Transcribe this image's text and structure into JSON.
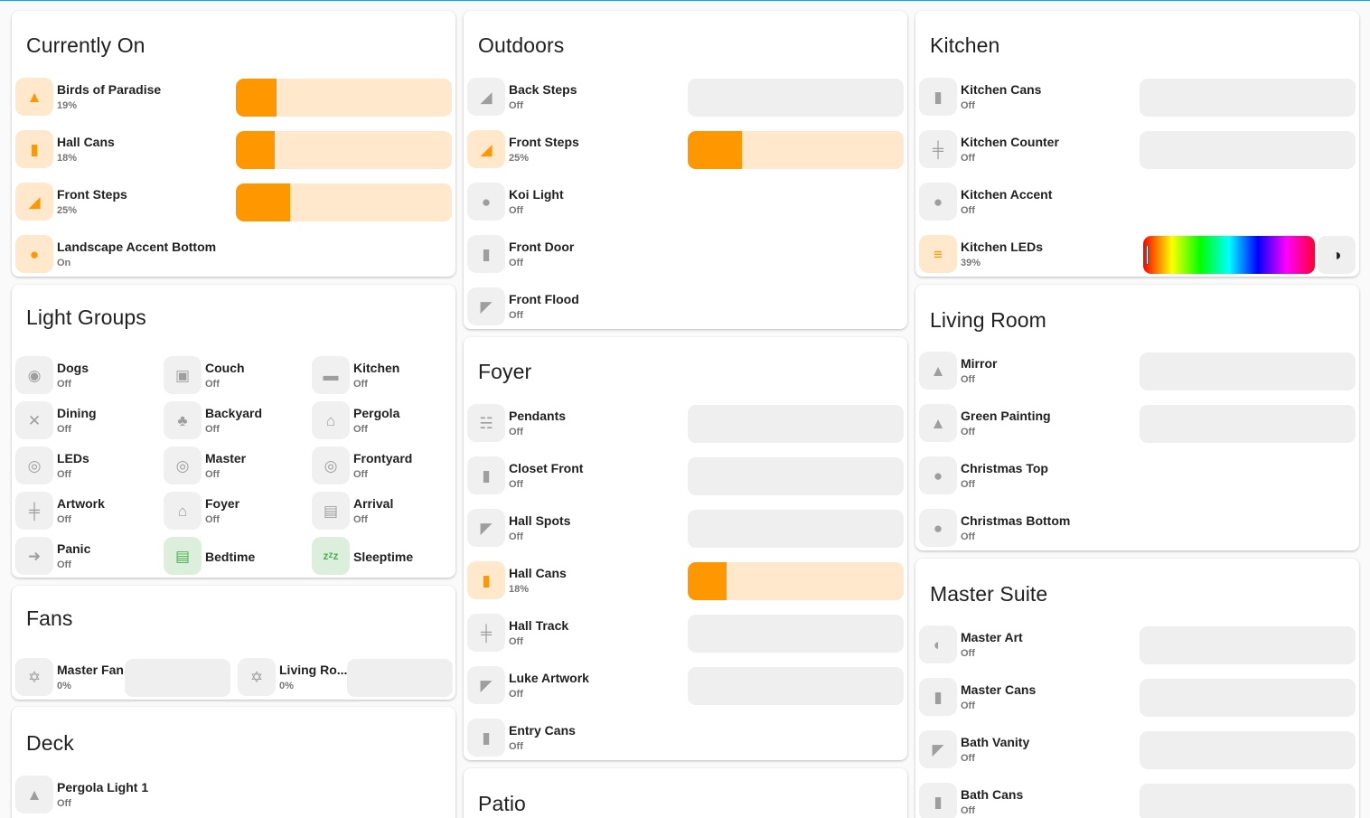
{
  "colors": {
    "accent": "#03a9f4",
    "on_orange": "#ff9800",
    "on_bg": "#ffe8cc",
    "off_bg": "#efefef",
    "scene_green": "#4caf50"
  },
  "currently_on": {
    "title": "Currently On",
    "rows": [
      {
        "name": "Birds of Paradise",
        "state": "19%",
        "icon": "ceiling-light-icon",
        "level": 0.19
      },
      {
        "name": "Hall Cans",
        "state": "18%",
        "icon": "can-light-icon",
        "level": 0.18
      },
      {
        "name": "Front Steps",
        "state": "25%",
        "icon": "stairs-light-icon",
        "level": 0.25
      },
      {
        "name": "Landscape Accent Bottom",
        "state": "On",
        "icon": "outlet-icon"
      }
    ]
  },
  "light_groups": {
    "title": "Light Groups",
    "tiles": [
      {
        "name": "Dogs",
        "state": "Off",
        "icon": "dog-icon"
      },
      {
        "name": "Couch",
        "state": "Off",
        "icon": "sofa-icon"
      },
      {
        "name": "Kitchen",
        "state": "Off",
        "icon": "pot-icon"
      },
      {
        "name": "Dining",
        "state": "Off",
        "icon": "silverware-icon"
      },
      {
        "name": "Backyard",
        "state": "Off",
        "icon": "tree-icon"
      },
      {
        "name": "Pergola",
        "state": "Off",
        "icon": "home-icon"
      },
      {
        "name": "LEDs",
        "state": "Off",
        "icon": "led-strip-icon"
      },
      {
        "name": "Master",
        "state": "Off",
        "icon": "led-strip-icon"
      },
      {
        "name": "Frontyard",
        "state": "Off",
        "icon": "led-strip-icon"
      },
      {
        "name": "Artwork",
        "state": "Off",
        "icon": "track-light-icon"
      },
      {
        "name": "Foyer",
        "state": "Off",
        "icon": "home-door-icon"
      },
      {
        "name": "Arrival",
        "state": "Off",
        "icon": "car-icon"
      },
      {
        "name": "Panic",
        "state": "Off",
        "icon": "run-icon"
      },
      {
        "name": "Bedtime",
        "state": "",
        "icon": "bed-icon"
      },
      {
        "name": "Sleeptime",
        "state": "",
        "icon": "sleep-icon"
      }
    ]
  },
  "fans": {
    "title": "Fans",
    "items": [
      {
        "name": "Master Fan",
        "state": "0%",
        "icon": "fan-icon"
      },
      {
        "name": "Living Ro...",
        "state": "0%",
        "icon": "fan-icon"
      }
    ]
  },
  "deck": {
    "title": "Deck",
    "rows": [
      {
        "name": "Pergola Light 1",
        "state": "Off",
        "icon": "ceiling-light-icon"
      }
    ]
  },
  "outdoors": {
    "title": "Outdoors",
    "rows": [
      {
        "name": "Back Steps",
        "state": "Off",
        "icon": "stairs-light-icon",
        "slider": true,
        "level": 0
      },
      {
        "name": "Front Steps",
        "state": "25%",
        "icon": "stairs-light-icon",
        "slider": true,
        "level": 0.25
      },
      {
        "name": "Koi Light",
        "state": "Off",
        "icon": "bulb-icon",
        "slider": false
      },
      {
        "name": "Front Door",
        "state": "Off",
        "icon": "can-light-icon",
        "slider": false
      },
      {
        "name": "Front Flood",
        "state": "Off",
        "icon": "flood-light-icon",
        "slider": false
      }
    ]
  },
  "foyer": {
    "title": "Foyer",
    "rows": [
      {
        "name": "Pendants",
        "state": "Off",
        "icon": "chandelier-icon",
        "slider": true,
        "level": 0
      },
      {
        "name": "Closet Front",
        "state": "Off",
        "icon": "can-light-icon",
        "slider": true,
        "level": 0
      },
      {
        "name": "Hall Spots",
        "state": "Off",
        "icon": "spot-light-icon",
        "slider": true,
        "level": 0
      },
      {
        "name": "Hall Cans",
        "state": "18%",
        "icon": "can-light-icon",
        "slider": true,
        "level": 0.18
      },
      {
        "name": "Hall Track",
        "state": "Off",
        "icon": "track-light-icon",
        "slider": true,
        "level": 0
      },
      {
        "name": "Luke Artwork",
        "state": "Off",
        "icon": "spot-light-icon",
        "slider": true,
        "level": 0
      },
      {
        "name": "Entry Cans",
        "state": "Off",
        "icon": "can-light-icon",
        "slider": false
      }
    ]
  },
  "patio": {
    "title": "Patio"
  },
  "kitchen": {
    "title": "Kitchen",
    "rows": [
      {
        "name": "Kitchen Cans",
        "state": "Off",
        "icon": "can-light-icon",
        "slider": true,
        "level": 0
      },
      {
        "name": "Kitchen Counter",
        "state": "Off",
        "icon": "track-light-icon",
        "slider": true,
        "level": 0
      },
      {
        "name": "Kitchen Accent",
        "state": "Off",
        "icon": "outlet-icon",
        "slider": false
      },
      {
        "name": "Kitchen LEDs",
        "state": "39%",
        "icon": "led-strip-icon",
        "level": 0.39
      }
    ]
  },
  "living_room": {
    "title": "Living Room",
    "rows": [
      {
        "name": "Mirror",
        "state": "Off",
        "icon": "ceiling-light-icon",
        "slider": true,
        "level": 0
      },
      {
        "name": "Green Painting",
        "state": "Off",
        "icon": "ceiling-light-icon",
        "slider": true,
        "level": 0
      },
      {
        "name": "Christmas Top",
        "state": "Off",
        "icon": "outlet-icon",
        "slider": false
      },
      {
        "name": "Christmas Bottom",
        "state": "Off",
        "icon": "outlet-icon",
        "slider": false
      }
    ]
  },
  "master_suite": {
    "title": "Master Suite",
    "rows": [
      {
        "name": "Master Art",
        "state": "Off",
        "icon": "wall-sconce-icon",
        "slider": true,
        "level": 0
      },
      {
        "name": "Master Cans",
        "state": "Off",
        "icon": "can-light-icon",
        "slider": true,
        "level": 0
      },
      {
        "name": "Bath Vanity",
        "state": "Off",
        "icon": "vanity-light-icon",
        "slider": true,
        "level": 0
      },
      {
        "name": "Bath Cans",
        "state": "Off",
        "icon": "can-light-icon",
        "slider": true,
        "level": 0
      }
    ]
  }
}
